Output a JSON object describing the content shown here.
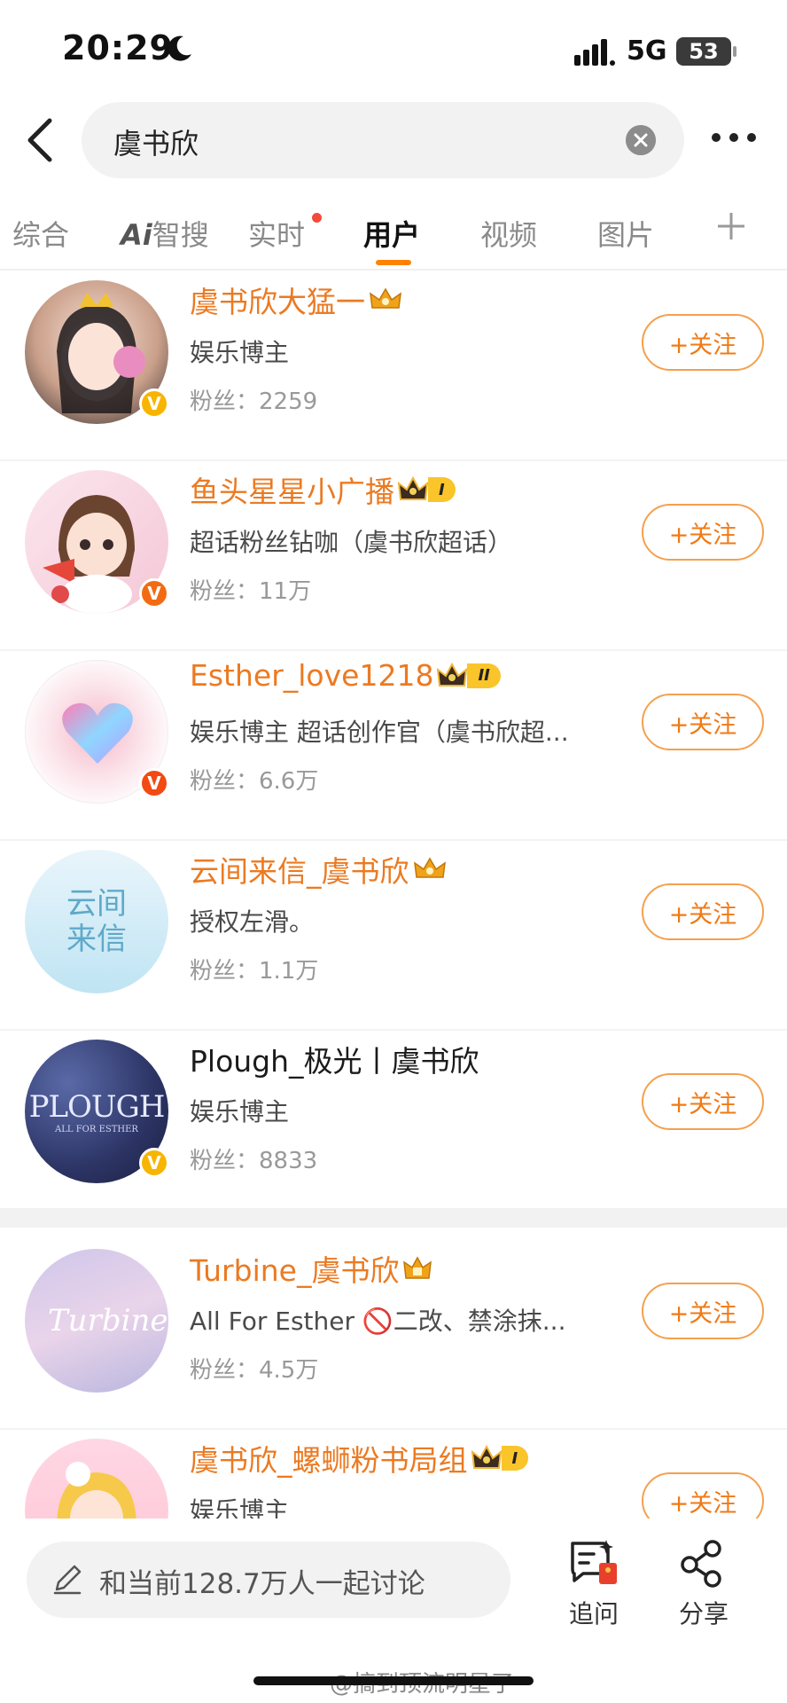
{
  "status_bar": {
    "time": "20:29",
    "network": "5G",
    "battery": "53"
  },
  "search": {
    "query": "虞书欣"
  },
  "tabs": [
    {
      "label": "综合"
    },
    {
      "label": "智搜",
      "prefix": "Ai"
    },
    {
      "label": "实时"
    },
    {
      "label": "用户"
    },
    {
      "label": "视频"
    },
    {
      "label": "图片"
    }
  ],
  "users": [
    {
      "name": "虞书欣大猛一",
      "desc": "娱乐博主",
      "fans": "粉丝：2259",
      "follow": "+关注",
      "verify": "V",
      "level": ""
    },
    {
      "name": "鱼头星星小广播",
      "desc": "超话粉丝钻咖（虞书欣超话）",
      "fans": "粉丝：11万",
      "follow": "+关注",
      "verify": "V",
      "level": "I"
    },
    {
      "name": "Esther_love1218",
      "desc": "娱乐博主 超话创作官（虞书欣超...",
      "fans": "粉丝：6.6万",
      "follow": "+关注",
      "verify": "V",
      "level": "II"
    },
    {
      "name": "云间来信_虞书欣",
      "desc": "授权左滑。",
      "fans": "粉丝：1.1万",
      "follow": "+关注",
      "verify": "",
      "level": "",
      "avatar_text": "云间来信"
    },
    {
      "name": "Plough_极光丨虞书欣",
      "desc": "娱乐博主",
      "fans": "粉丝：8833",
      "follow": "+关注",
      "verify": "V",
      "level": "",
      "avatar_text": "PLOUGH",
      "avatar_sub": "ALL FOR ESTHER"
    },
    {
      "name": "Turbine_虞书欣",
      "desc": "All For Esther 🚫二改、禁涂抹...",
      "fans": "粉丝：4.5万",
      "follow": "+关注",
      "verify": "",
      "level": "",
      "avatar_text": "Turbine"
    },
    {
      "name": "虞书欣_螺蛳粉书局组",
      "desc": "娱乐博主",
      "fans": "",
      "follow": "+关注",
      "verify": "",
      "level": "I"
    }
  ],
  "bottom_bar": {
    "discuss": "和当前128.7万人一起讨论",
    "ask": "追问",
    "share": "分享"
  },
  "watermark": "@搞到顶流明星了",
  "colors": {
    "accent": "#ff8200",
    "name_orange": "#eb7a22",
    "verify_gold": "#f7b500",
    "verify_orange": "#f26b12"
  }
}
